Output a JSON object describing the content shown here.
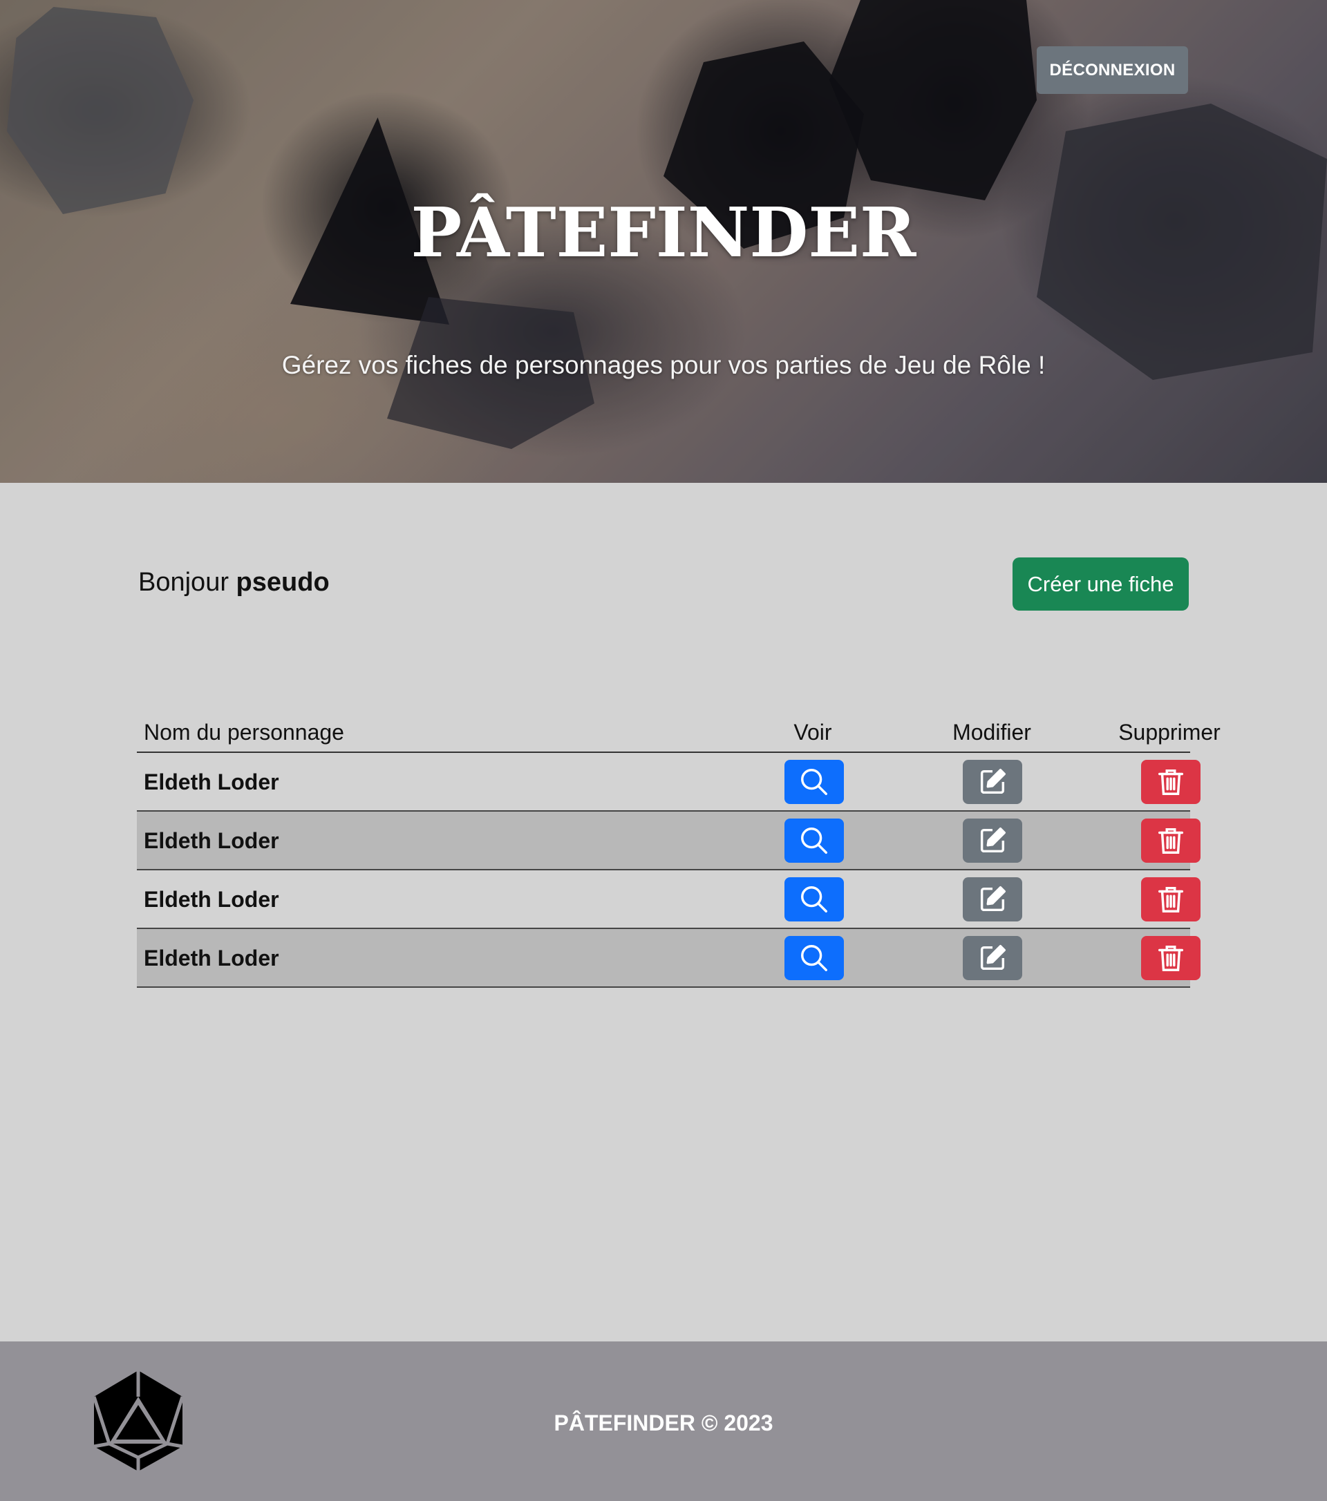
{
  "header": {
    "logout_label": "DÉCONNEXION",
    "title": "PÂTEFINDER",
    "tagline": "Gérez vos fiches de personnages pour vos parties de Jeu de Rôle !"
  },
  "main": {
    "greeting_prefix": "Bonjour",
    "username": "pseudo",
    "create_label": "Créer une fiche"
  },
  "table": {
    "headers": {
      "name": "Nom du personnage",
      "view": "Voir",
      "edit": "Modifier",
      "delete": "Supprimer"
    },
    "rows": [
      {
        "name": "Eldeth Loder"
      },
      {
        "name": "Eldeth Loder"
      },
      {
        "name": "Eldeth Loder"
      },
      {
        "name": "Eldeth Loder"
      }
    ]
  },
  "footer": {
    "text": "PÂTEFINDER © 2023",
    "logo_icon": "d20-dice-icon"
  },
  "icons": {
    "view": "search-icon",
    "edit": "edit-icon",
    "delete": "trash-icon"
  },
  "colors": {
    "view_button": "#0d6efd",
    "edit_button": "#6c757d",
    "delete_button": "#dc3545",
    "create_button": "#198754",
    "logout_button": "#6c757d",
    "footer": "#939197",
    "page_background": "#d3d3d3"
  }
}
